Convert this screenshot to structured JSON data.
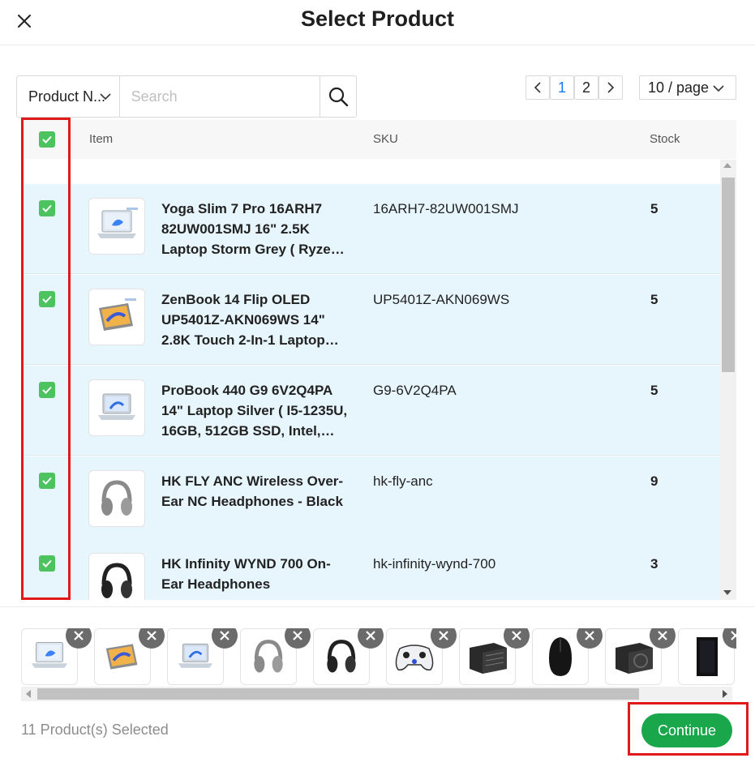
{
  "modal": {
    "title": "Select Product"
  },
  "search": {
    "field": "Product N...",
    "placeholder": "Search"
  },
  "pagination": {
    "pages": [
      "1",
      "2"
    ],
    "current": "1",
    "page_size": "10 / page"
  },
  "table": {
    "headers": {
      "item": "Item",
      "sku": "SKU",
      "stock": "Stock"
    },
    "rows": [
      {
        "name": "Yoga Slim 7 Pro 16ARH7 82UW001SMJ 16\" 2.5K Laptop Storm Grey ( Ryzen …",
        "sku": "16ARH7-82UW001SMJ",
        "stock": "5",
        "icon": "laptop-image",
        "checked": true
      },
      {
        "name": "ZenBook 14 Flip OLED UP5401Z-AKN069WS 14\" 2.8K Touch 2-In-1 Laptop…",
        "sku": "UP5401Z-AKN069WS",
        "stock": "5",
        "icon": "flip-laptop-image",
        "checked": true
      },
      {
        "name": "ProBook 440 G9 6V2Q4PA 14\" Laptop Silver ( I5-1235U, 16GB, 512GB SSD, Intel,…",
        "sku": "G9-6V2Q4PA",
        "stock": "5",
        "icon": "laptop-image",
        "checked": true
      },
      {
        "name": "HK FLY ANC Wireless Over-Ear NC Headphones - Black",
        "sku": "hk-fly-anc",
        "stock": "9",
        "icon": "headphones-image",
        "checked": true
      },
      {
        "name": "HK Infinity WYND 700 On-Ear Headphones",
        "sku": "hk-infinity-wynd-700",
        "stock": "3",
        "icon": "headphones-image",
        "checked": true
      }
    ]
  },
  "selected": {
    "count_text": "11 Product(s) Selected",
    "items": [
      "laptop-image",
      "flip-laptop-image",
      "laptop-image",
      "headphones-grey-image",
      "headphones-black-image",
      "gamepad-image",
      "power-supply-image",
      "mouse-image",
      "power-supply-image",
      "pc-case-image"
    ]
  },
  "actions": {
    "continue_label": "Continue"
  },
  "colors": {
    "accent": "#1aa64b",
    "checkbox": "#4cc35f",
    "row_highlight": "#e7f6fd",
    "annotation": "#e01a1a",
    "active_page": "#1677ff"
  }
}
